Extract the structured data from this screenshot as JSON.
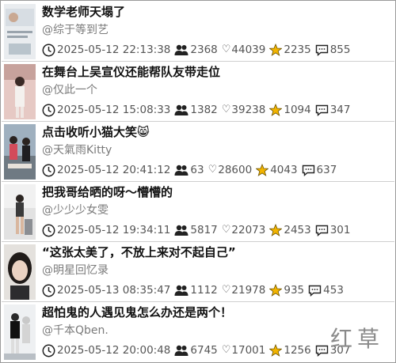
{
  "colors": {
    "accent_star": "#f2b400",
    "text": "#111111",
    "muted": "#7a7a7a",
    "divider": "#cfcfcf"
  },
  "icons": {
    "time": "clock-icon",
    "users": "users-icon",
    "likes": "heart-icon",
    "favorites": "star-icon",
    "comments": "comment-icon"
  },
  "watermark": "红草",
  "items": [
    {
      "title": "数学老师天塌了",
      "author": "@综于等到艺",
      "time": "2025-05-12 22:13:38",
      "users": "2368",
      "likes": "44039",
      "stars": "2235",
      "comments": "855"
    },
    {
      "title": "在舞台上吴宣仪还能帮队友带走位",
      "author": "@仅此一个",
      "time": "2025-05-12 15:08:33",
      "users": "1382",
      "likes": "39238",
      "stars": "1094",
      "comments": "347"
    },
    {
      "title": "点击收听小猫大笑😸",
      "author": "@天氣雨Kitty",
      "time": "2025-05-12 20:41:12",
      "users": "63",
      "likes": "28600",
      "stars": "4043",
      "comments": "637"
    },
    {
      "title": "把我哥给晒的呀～懵懵的",
      "author": "@少少少女雯",
      "time": "2025-05-12 19:34:11",
      "users": "5817",
      "likes": "22073",
      "stars": "2453",
      "comments": "301"
    },
    {
      "title": "“这张太美了，不放上来对不起自己”",
      "author": "@明星回忆录",
      "time": "2025-05-13 08:35:47",
      "users": "1112",
      "likes": "21978",
      "stars": "935",
      "comments": "453"
    },
    {
      "title": "超怕鬼的人遇见鬼怎么办还是两个！",
      "author": "@千本Qben.",
      "time": "2025-05-12 20:00:48",
      "users": "6745",
      "likes": "17001",
      "stars": "1256",
      "comments": "307"
    }
  ]
}
